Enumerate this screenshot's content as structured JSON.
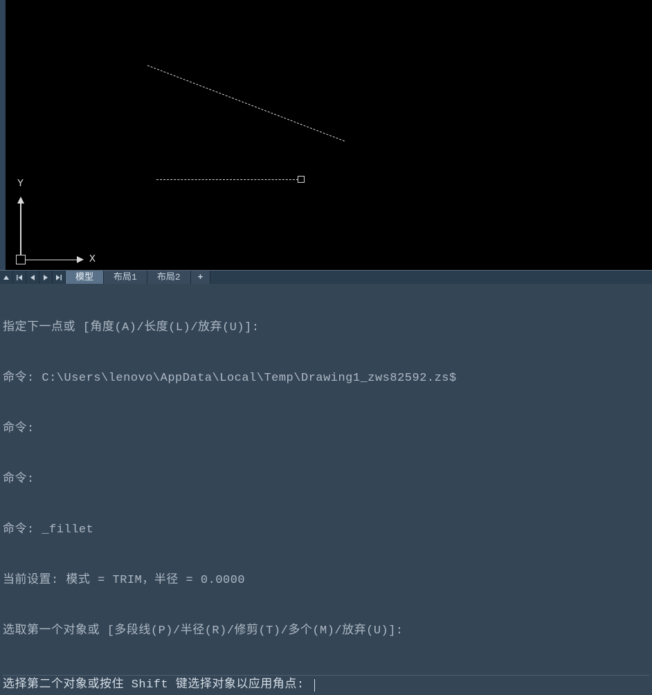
{
  "ucs": {
    "x_label": "X",
    "y_label": "Y"
  },
  "tabs": {
    "model": "模型",
    "layout1": "布局1",
    "layout2": "布局2",
    "add": "+"
  },
  "cmd": {
    "lines": [
      "指定下一点或 [角度(A)/长度(L)/放弃(U)]:",
      "命令: C:\\Users\\lenovo\\AppData\\Local\\Temp\\Drawing1_zws82592.zs$",
      "命令:",
      "命令:",
      "命令: _fillet",
      "当前设置: 模式 = TRIM，半径 = 0.0000",
      "选取第一个对象或 [多段线(P)/半径(R)/修剪(T)/多个(M)/放弃(U)]:"
    ],
    "prompt": "选择第二个对象或按住 Shift 键选择对象以应用角点: "
  }
}
